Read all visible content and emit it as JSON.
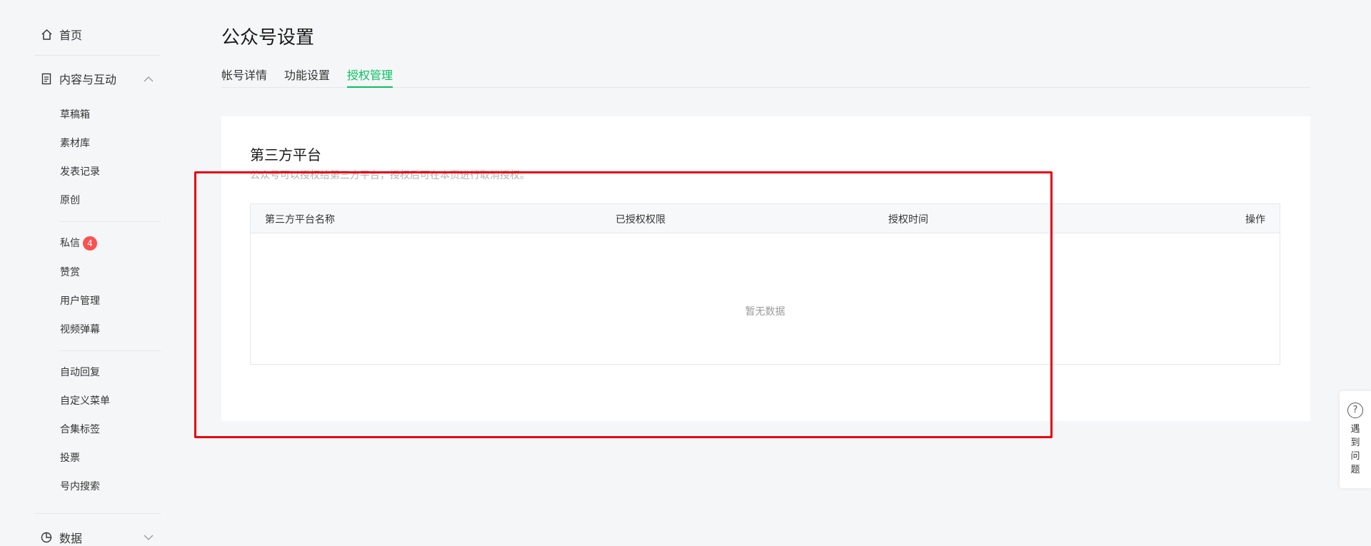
{
  "sidebar": {
    "home": "首页",
    "content_group": "内容与互动",
    "content_items": [
      "草稿箱",
      "素材库",
      "发表记录",
      "原创"
    ],
    "interact_items": [
      {
        "label": "私信",
        "badge": "4"
      },
      {
        "label": "赞赏"
      },
      {
        "label": "用户管理"
      },
      {
        "label": "视频弹幕"
      }
    ],
    "tool_items": [
      "自动回复",
      "自定义菜单",
      "合集标签",
      "投票",
      "号内搜索"
    ],
    "data_group": "数据"
  },
  "main": {
    "title": "公众号设置",
    "tabs": [
      {
        "label": "帐号详情",
        "active": false
      },
      {
        "label": "功能设置",
        "active": false
      },
      {
        "label": "授权管理",
        "active": true
      }
    ],
    "section": {
      "title": "第三方平台",
      "description": "公众号可以授权给第三方平台，授权后可在本页进行取消授权。",
      "columns": [
        "第三方平台名称",
        "已授权权限",
        "授权时间",
        "操作"
      ],
      "empty_text": "暂无数据"
    }
  },
  "help": {
    "icon": "?",
    "label": "遇到问题"
  },
  "colors": {
    "accent": "#07c160",
    "badge": "#fa5151",
    "highlight": "#e60012"
  }
}
